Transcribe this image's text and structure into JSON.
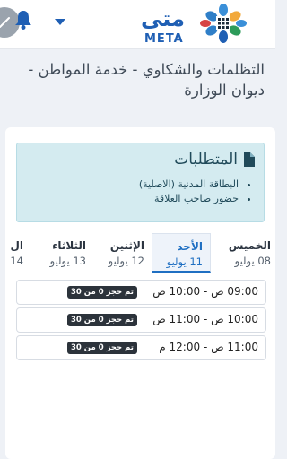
{
  "header": {
    "logo_text": "متى",
    "logo_latin": "META",
    "brand_color": "#1f5fb4"
  },
  "page_title": "التظلمات والشكاوي - خدمة المواطن - ديوان الوزارة",
  "requirements": {
    "title": "المتطلبات",
    "items": [
      "البطاقة المدنية (الاصلية)",
      "حضور صاحب العلاقة"
    ]
  },
  "days": [
    {
      "name": "الخميس",
      "date": "08 يوليو",
      "active": false
    },
    {
      "name": "الأحد",
      "date": "11 يوليو",
      "active": true
    },
    {
      "name": "الإثنين",
      "date": "12 يوليو",
      "active": false
    },
    {
      "name": "الثلاثاء",
      "date": "13 يوليو",
      "active": false
    },
    {
      "name": "ال",
      "date": "14",
      "active": false
    }
  ],
  "slots": [
    {
      "time": "09:00 ص - 10:00 ص",
      "badge": "تم حجز 0 من 30"
    },
    {
      "time": "10:00 ص - 11:00 ص",
      "badge": "تم حجز 0 من 30"
    },
    {
      "time": "11:00 ص - 12:00 م",
      "badge": "تم حجز 0 من 30"
    }
  ],
  "icons": {
    "back": "back-arrow-icon",
    "notifications": "bell-icon",
    "menu": "caret-down-icon",
    "requirements": "document-icon"
  },
  "colors": {
    "accent": "#1f6fc2",
    "alert_bg": "#d4ebf0",
    "badge_bg": "#2c333b"
  }
}
